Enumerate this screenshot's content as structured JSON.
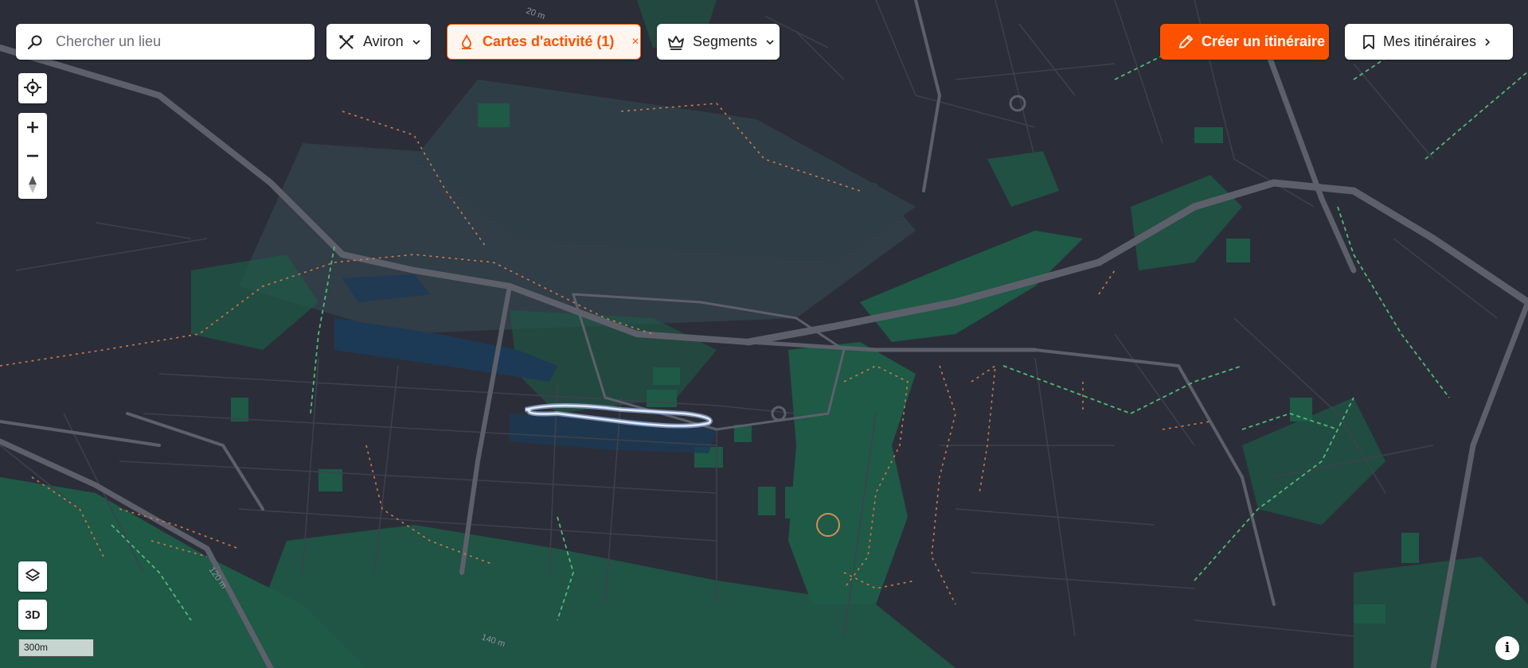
{
  "search": {
    "placeholder": "Chercher un lieu",
    "icon": "search-icon"
  },
  "filters": {
    "sport": {
      "label": "Aviron",
      "icon": "rowing-icon"
    },
    "heatmap": {
      "label": "Cartes d'activité (1)",
      "icon": "heatmap-flame-icon",
      "accent": "#fc5200"
    },
    "segments": {
      "label": "Segments",
      "icon": "segment-crown-icon"
    }
  },
  "actions": {
    "create_route": {
      "label": "Créer un itinéraire",
      "icon": "pencil-icon",
      "color": "#fc5200"
    },
    "my_routes": {
      "label": "Mes itinéraires",
      "icon": "bookmark-icon"
    }
  },
  "map_controls": {
    "mode_3d": "3D",
    "scale_label": "300m",
    "info": "i"
  },
  "contour_labels": [
    "20 m",
    "120 m",
    "140 m"
  ],
  "colors": {
    "map_bg": "#2b2e38",
    "park": "#1e5a46",
    "road": "#4b4e58",
    "major_road": "#5d606a",
    "water": "#1c3a55",
    "trail": "#c97a4f",
    "bike_path": "#52b77a",
    "activity_heat": "#c9d6f0"
  }
}
